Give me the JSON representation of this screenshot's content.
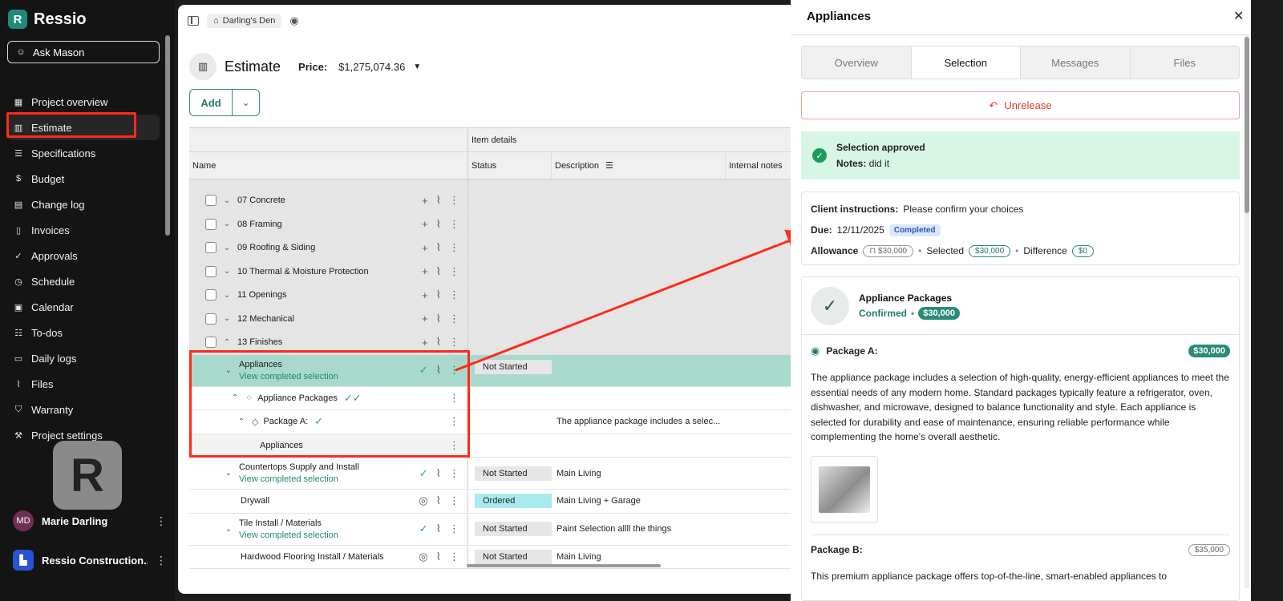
{
  "app": {
    "name": "Ressio",
    "logo_letter": "R"
  },
  "sidebar": {
    "ask_label": "Ask Mason",
    "items": [
      {
        "label": "Project overview",
        "icon": "layout-icon"
      },
      {
        "label": "Estimate",
        "icon": "chart-icon",
        "active": true
      },
      {
        "label": "Specifications",
        "icon": "list-icon"
      },
      {
        "label": "Budget",
        "icon": "dollar-icon"
      },
      {
        "label": "Change log",
        "icon": "document-icon"
      },
      {
        "label": "Invoices",
        "icon": "receipt-icon"
      },
      {
        "label": "Approvals",
        "icon": "approval-icon"
      },
      {
        "label": "Schedule",
        "icon": "clock-icon"
      },
      {
        "label": "Calendar",
        "icon": "calendar-icon"
      },
      {
        "label": "To-dos",
        "icon": "todo-icon"
      },
      {
        "label": "Daily logs",
        "icon": "book-icon"
      },
      {
        "label": "Files",
        "icon": "paperclip-icon"
      },
      {
        "label": "Warranty",
        "icon": "shield-icon"
      },
      {
        "label": "Project settings",
        "icon": "wrench-icon"
      }
    ],
    "user": {
      "initials": "MD",
      "name": "Marie Darling"
    },
    "org": {
      "name": "Ressio Construction..."
    }
  },
  "topbar": {
    "project": "Darling's Den"
  },
  "estimate": {
    "title": "Estimate",
    "price_label": "Price:",
    "price_value": "$1,275,074.36",
    "add_label": "Add"
  },
  "table": {
    "group_header": "Item details",
    "columns": {
      "name": "Name",
      "status": "Status",
      "description": "Description",
      "internal_notes": "Internal notes"
    },
    "sections": [
      "07 Concrete",
      "08 Framing",
      "09 Roofing & Siding",
      "10 Thermal & Moisture Protection",
      "11 Openings",
      "12 Mechanical",
      "13 Finishes"
    ],
    "appliances": {
      "name": "Appliances",
      "link": "View completed selection",
      "status": "Not Started"
    },
    "appliance_packages": "Appliance Packages",
    "package_a": {
      "name": "Package A:",
      "description": "The appliance package includes a selec..."
    },
    "appliances_child": "Appliances",
    "countertops": {
      "name": "Countertops Supply and Install",
      "link": "View completed selection",
      "status": "Not Started",
      "description": "Main Living"
    },
    "drywall": {
      "name": "Drywall",
      "status": "Ordered",
      "description": "Main Living + Garage"
    },
    "tile": {
      "name": "Tile Install / Materials",
      "link": "View completed selection",
      "status": "Not Started",
      "description": "Paint Selection allll the things"
    },
    "hardwood": {
      "name": "Hardwood Flooring Install / Materials",
      "status": "Not Started",
      "description": "Main Living"
    }
  },
  "drawer": {
    "title": "Appliances",
    "tabs": [
      "Overview",
      "Selection",
      "Messages",
      "Files"
    ],
    "active_tab": "Selection",
    "unrelease_label": "Unrelease",
    "approved_title": "Selection approved",
    "notes_label": "Notes:",
    "notes_value": "did it",
    "client_instructions_label": "Client instructions:",
    "client_instructions_value": "Please confirm your choices",
    "due_label": "Due:",
    "due_value": "12/11/2025",
    "due_badge": "Completed",
    "allowance_label": "Allowance",
    "allowance_value": "$30,000",
    "selected_label": "Selected",
    "selected_value": "$30,000",
    "difference_label": "Difference",
    "difference_value": "$0",
    "package_group": "Appliance Packages",
    "confirmed_label": "Confirmed",
    "confirmed_value": "$30,000",
    "package_a_title": "Package A:",
    "package_a_price": "$30,000",
    "package_a_desc": "The appliance package includes a selection of high-quality, energy-efficient appliances to meet the essential needs of any modern home. Standard packages typically feature a refrigerator, oven, dishwasher, and microwave, designed to balance functionality and style. Each appliance is selected for durability and ease of maintenance, ensuring reliable performance while complementing the home's overall aesthetic.",
    "package_b_title": "Package B:",
    "package_b_price": "$35,000",
    "package_b_desc": "This premium appliance package offers top-of-the-line, smart-enabled appliances to"
  },
  "colors": {
    "accent": "#1f7b6b",
    "highlight": "#ff2a1a",
    "approved_bg": "#d7f6e6"
  }
}
